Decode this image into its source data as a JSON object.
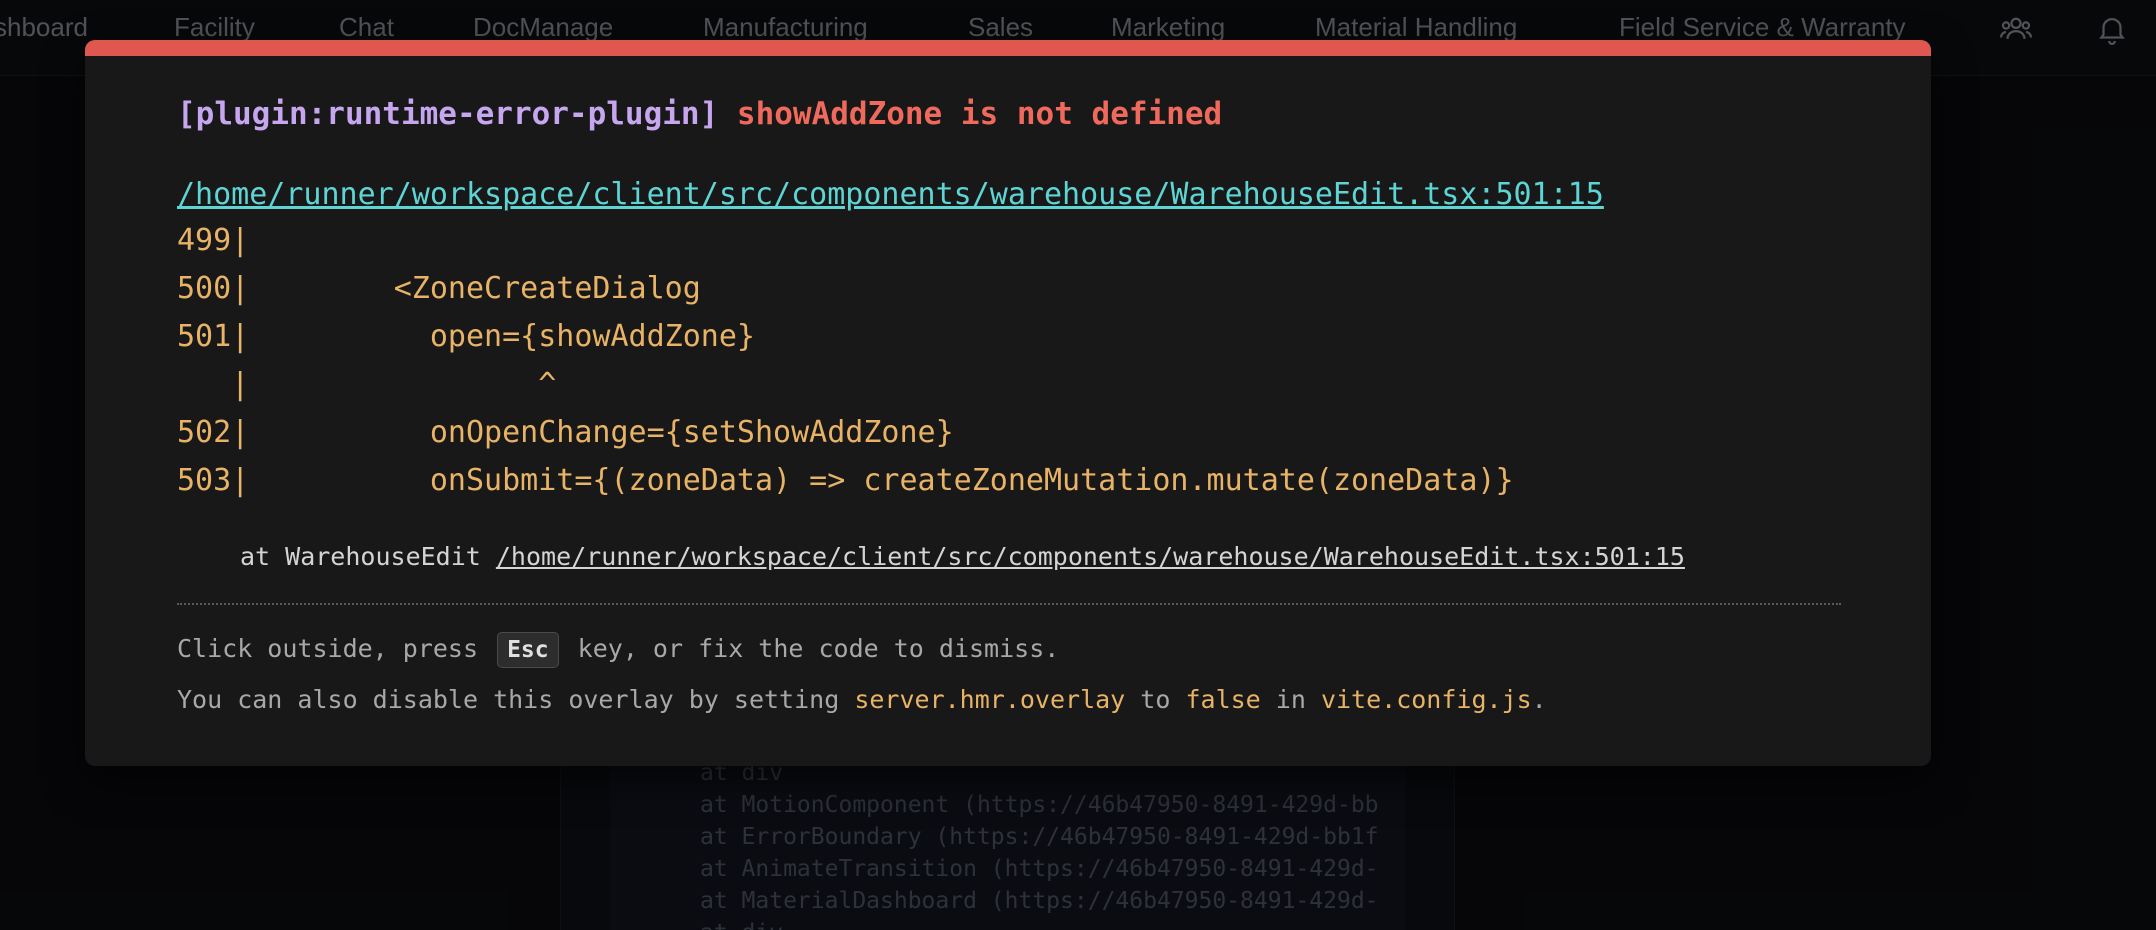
{
  "nav": {
    "items": [
      "shboard",
      "Facility",
      "Chat",
      "DocManage",
      "Manufacturing",
      "Sales",
      "Marketing",
      "Material Handling",
      "Field Service & Warranty"
    ],
    "icons": [
      "users-icon",
      "bell-icon"
    ]
  },
  "background_stack": [
    "at div",
    "at MotionComponent (https://46b47950-8491-429d-bb",
    "at ErrorBoundary (https://46b47950-8491-429d-bb1f",
    "at AnimateTransition (https://46b47950-8491-429d-",
    "at MaterialDashboard (https://46b47950-8491-429d-",
    "at div"
  ],
  "overlay": {
    "accent_color": "#e0574f",
    "plugin": "[plugin:runtime-error-plugin]",
    "message": "showAddZone is not defined",
    "file": "/home/runner/workspace/client/src/components/warehouse/WarehouseEdit.tsx:501:15",
    "code_frame": [
      "499|",
      "500|        <ZoneCreateDialog",
      "501|          open={showAddZone}",
      "   |                ^",
      "502|          onOpenChange={setShowAddZone}",
      "503|          onSubmit={(zoneData) => createZoneMutation.mutate(zoneData)}"
    ],
    "stack_prefix": "at WarehouseEdit ",
    "stack_path": "/home/runner/workspace/client/src/components/warehouse/WarehouseEdit.tsx:501:15",
    "tip1": {
      "before": "Click outside, press ",
      "key": "Esc",
      "after": " key, or fix the code to dismiss."
    },
    "tip2": {
      "t1": "You can also disable this overlay by setting ",
      "h1": "server.hmr.overlay",
      "t2": " to ",
      "h2": "false",
      "t3": " in ",
      "h3": "vite.config.js",
      "t4": "."
    }
  }
}
